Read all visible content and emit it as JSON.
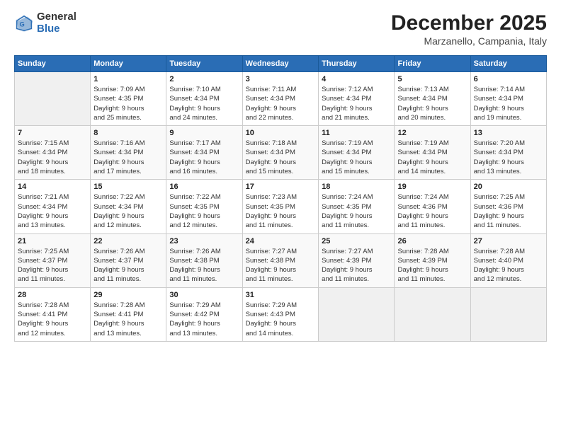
{
  "logo": {
    "general": "General",
    "blue": "Blue"
  },
  "title": "December 2025",
  "subtitle": "Marzanello, Campania, Italy",
  "days_header": [
    "Sunday",
    "Monday",
    "Tuesday",
    "Wednesday",
    "Thursday",
    "Friday",
    "Saturday"
  ],
  "weeks": [
    [
      {
        "day": "",
        "info": ""
      },
      {
        "day": "1",
        "info": "Sunrise: 7:09 AM\nSunset: 4:35 PM\nDaylight: 9 hours\nand 25 minutes."
      },
      {
        "day": "2",
        "info": "Sunrise: 7:10 AM\nSunset: 4:34 PM\nDaylight: 9 hours\nand 24 minutes."
      },
      {
        "day": "3",
        "info": "Sunrise: 7:11 AM\nSunset: 4:34 PM\nDaylight: 9 hours\nand 22 minutes."
      },
      {
        "day": "4",
        "info": "Sunrise: 7:12 AM\nSunset: 4:34 PM\nDaylight: 9 hours\nand 21 minutes."
      },
      {
        "day": "5",
        "info": "Sunrise: 7:13 AM\nSunset: 4:34 PM\nDaylight: 9 hours\nand 20 minutes."
      },
      {
        "day": "6",
        "info": "Sunrise: 7:14 AM\nSunset: 4:34 PM\nDaylight: 9 hours\nand 19 minutes."
      }
    ],
    [
      {
        "day": "7",
        "info": "Sunrise: 7:15 AM\nSunset: 4:34 PM\nDaylight: 9 hours\nand 18 minutes."
      },
      {
        "day": "8",
        "info": "Sunrise: 7:16 AM\nSunset: 4:34 PM\nDaylight: 9 hours\nand 17 minutes."
      },
      {
        "day": "9",
        "info": "Sunrise: 7:17 AM\nSunset: 4:34 PM\nDaylight: 9 hours\nand 16 minutes."
      },
      {
        "day": "10",
        "info": "Sunrise: 7:18 AM\nSunset: 4:34 PM\nDaylight: 9 hours\nand 15 minutes."
      },
      {
        "day": "11",
        "info": "Sunrise: 7:19 AM\nSunset: 4:34 PM\nDaylight: 9 hours\nand 15 minutes."
      },
      {
        "day": "12",
        "info": "Sunrise: 7:19 AM\nSunset: 4:34 PM\nDaylight: 9 hours\nand 14 minutes."
      },
      {
        "day": "13",
        "info": "Sunrise: 7:20 AM\nSunset: 4:34 PM\nDaylight: 9 hours\nand 13 minutes."
      }
    ],
    [
      {
        "day": "14",
        "info": "Sunrise: 7:21 AM\nSunset: 4:34 PM\nDaylight: 9 hours\nand 13 minutes."
      },
      {
        "day": "15",
        "info": "Sunrise: 7:22 AM\nSunset: 4:34 PM\nDaylight: 9 hours\nand 12 minutes."
      },
      {
        "day": "16",
        "info": "Sunrise: 7:22 AM\nSunset: 4:35 PM\nDaylight: 9 hours\nand 12 minutes."
      },
      {
        "day": "17",
        "info": "Sunrise: 7:23 AM\nSunset: 4:35 PM\nDaylight: 9 hours\nand 11 minutes."
      },
      {
        "day": "18",
        "info": "Sunrise: 7:24 AM\nSunset: 4:35 PM\nDaylight: 9 hours\nand 11 minutes."
      },
      {
        "day": "19",
        "info": "Sunrise: 7:24 AM\nSunset: 4:36 PM\nDaylight: 9 hours\nand 11 minutes."
      },
      {
        "day": "20",
        "info": "Sunrise: 7:25 AM\nSunset: 4:36 PM\nDaylight: 9 hours\nand 11 minutes."
      }
    ],
    [
      {
        "day": "21",
        "info": "Sunrise: 7:25 AM\nSunset: 4:37 PM\nDaylight: 9 hours\nand 11 minutes."
      },
      {
        "day": "22",
        "info": "Sunrise: 7:26 AM\nSunset: 4:37 PM\nDaylight: 9 hours\nand 11 minutes."
      },
      {
        "day": "23",
        "info": "Sunrise: 7:26 AM\nSunset: 4:38 PM\nDaylight: 9 hours\nand 11 minutes."
      },
      {
        "day": "24",
        "info": "Sunrise: 7:27 AM\nSunset: 4:38 PM\nDaylight: 9 hours\nand 11 minutes."
      },
      {
        "day": "25",
        "info": "Sunrise: 7:27 AM\nSunset: 4:39 PM\nDaylight: 9 hours\nand 11 minutes."
      },
      {
        "day": "26",
        "info": "Sunrise: 7:28 AM\nSunset: 4:39 PM\nDaylight: 9 hours\nand 11 minutes."
      },
      {
        "day": "27",
        "info": "Sunrise: 7:28 AM\nSunset: 4:40 PM\nDaylight: 9 hours\nand 12 minutes."
      }
    ],
    [
      {
        "day": "28",
        "info": "Sunrise: 7:28 AM\nSunset: 4:41 PM\nDaylight: 9 hours\nand 12 minutes."
      },
      {
        "day": "29",
        "info": "Sunrise: 7:28 AM\nSunset: 4:41 PM\nDaylight: 9 hours\nand 13 minutes."
      },
      {
        "day": "30",
        "info": "Sunrise: 7:29 AM\nSunset: 4:42 PM\nDaylight: 9 hours\nand 13 minutes."
      },
      {
        "day": "31",
        "info": "Sunrise: 7:29 AM\nSunset: 4:43 PM\nDaylight: 9 hours\nand 14 minutes."
      },
      {
        "day": "",
        "info": ""
      },
      {
        "day": "",
        "info": ""
      },
      {
        "day": "",
        "info": ""
      }
    ]
  ]
}
